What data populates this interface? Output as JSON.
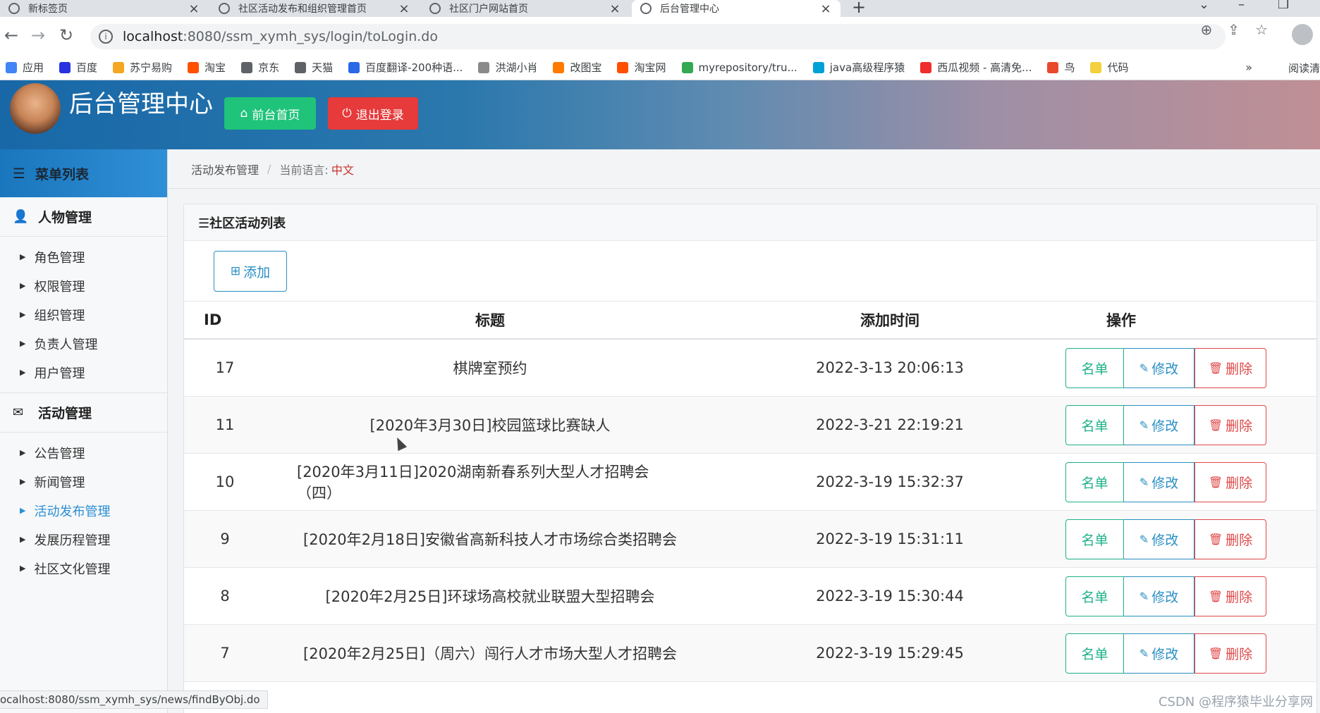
{
  "browser": {
    "tabs": [
      {
        "title": "新标签页",
        "active": false
      },
      {
        "title": "社区活动发布和组织管理首页",
        "active": false
      },
      {
        "title": "社区门户网站首页",
        "active": false
      },
      {
        "title": "后台管理中心",
        "active": true
      }
    ],
    "new_tab": "+",
    "url_host": "localhost",
    "url_rest": ":8080/ssm_xymh_sys/login/toLogin.do",
    "bookmarks": [
      {
        "label": "应用",
        "color": "#4285f4"
      },
      {
        "label": "百度",
        "color": "#2932e1"
      },
      {
        "label": "苏宁易购",
        "color": "#f5a623"
      },
      {
        "label": "淘宝",
        "color": "#ff5000"
      },
      {
        "label": "京东",
        "color": "#5f6368"
      },
      {
        "label": "天猫",
        "color": "#5f6368"
      },
      {
        "label": "百度翻译-200种语...",
        "color": "#2b68e6"
      },
      {
        "label": "洪湖小肖",
        "color": "#8a8a8a"
      },
      {
        "label": "改图宝",
        "color": "#ff7a00"
      },
      {
        "label": "淘宝网",
        "color": "#ff5000"
      },
      {
        "label": "myrepository/tru...",
        "color": "#34a853"
      },
      {
        "label": "java高级程序猿",
        "color": "#00a1d6"
      },
      {
        "label": "西瓜视频 - 高清免...",
        "color": "#f02c2c"
      },
      {
        "label": "鸟",
        "color": "#e94a2c"
      },
      {
        "label": "代码",
        "color": "#f4d03f"
      }
    ],
    "bookmarks_more": "»",
    "reading_list": "阅读清",
    "status_url": "ocalhost:8080/ssm_xymh_sys/news/findByObj.do"
  },
  "header": {
    "title": "后台管理中心",
    "home_button": "前台首页",
    "logout_button": "退出登录"
  },
  "sidebar": {
    "menu_title": "菜单列表",
    "groups": [
      {
        "title": "人物管理",
        "items": [
          "角色管理",
          "权限管理",
          "组织管理",
          "负责人管理",
          "用户管理"
        ]
      },
      {
        "title": "活动管理",
        "items": [
          "公告管理",
          "新闻管理",
          "活动发布管理",
          "发展历程管理",
          "社区文化管理"
        ]
      }
    ],
    "active_item": "活动发布管理"
  },
  "breadcrumb": {
    "current": "活动发布管理",
    "separator": "/",
    "lang_label": "当前语言:",
    "lang_value": "中文"
  },
  "panel": {
    "title": "☰社区活动列表",
    "add_button": "添加",
    "columns": [
      "ID",
      "标题",
      "添加时间",
      "操作"
    ],
    "rows": [
      {
        "id": "17",
        "title": "棋牌室预约",
        "time": "2022-3-13 20:06:13"
      },
      {
        "id": "11",
        "title": "[2020年3月30日]校园篮球比赛缺人",
        "time": "2022-3-21 22:19:21"
      },
      {
        "id": "10",
        "title": "[2020年3月11日]2020湖南新春系列大型人才招聘会（四）",
        "time": "2022-3-19 15:32:37"
      },
      {
        "id": "9",
        "title": "[2020年2月18日]安徽省高新科技人才市场综合类招聘会",
        "time": "2022-3-19 15:31:11"
      },
      {
        "id": "8",
        "title": "[2020年2月25日]环球场高校就业联盟大型招聘会",
        "time": "2022-3-19 15:30:44"
      },
      {
        "id": "7",
        "title": "[2020年2月25日]（周六）闯行人才市场大型人才招聘会",
        "time": "2022-3-19 15:29:45"
      }
    ],
    "row_actions": {
      "list": "名单",
      "edit": "修改",
      "delete": "删除"
    }
  },
  "watermark": "CSDN @程序猿毕业分享网"
}
